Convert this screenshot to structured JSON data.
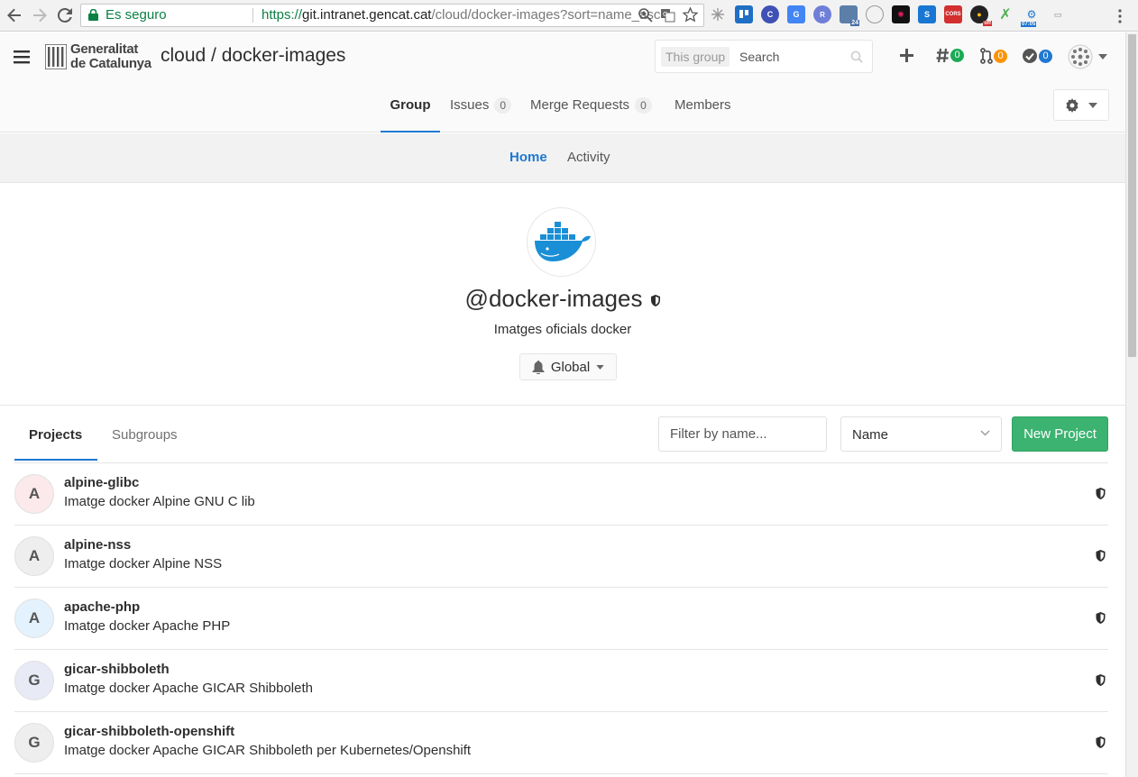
{
  "browser": {
    "secure_label": "Es seguro",
    "url_scheme": "https://",
    "url_host": "git.intranet.gencat.cat",
    "url_path": "/cloud/docker-images?sort=name_asc",
    "extensions": [
      "trello-icon",
      "c-icon",
      "translate-icon",
      "r-icon",
      "calendar-icon",
      "circle-icon",
      "dark-icon",
      "s-icon",
      "cors-icon",
      "chrome-off-icon",
      "spell-icon",
      "clock-icon",
      "ext-icon"
    ],
    "ext_cors": "CORS",
    "ext_off": "off",
    "ext_time": "07:05",
    "ext_cal": "24"
  },
  "header": {
    "logo_line1": "Generalitat",
    "logo_line2": "de Catalunya",
    "title": "cloud / docker-images",
    "search_scope": "This group",
    "search_placeholder": "Search",
    "issues_count": "0",
    "mr_count": "0",
    "todos_count": "0",
    "colors": {
      "issues": "#1aaa55",
      "mr": "#fc9403",
      "todos": "#1f78d1"
    }
  },
  "group_nav": {
    "tabs": [
      {
        "label": "Group"
      },
      {
        "label": "Issues",
        "badge": "0"
      },
      {
        "label": "Merge Requests",
        "badge": "0"
      },
      {
        "label": "Members"
      }
    ]
  },
  "sub_nav": {
    "tabs": [
      "Home",
      "Activity"
    ]
  },
  "group": {
    "name": "@docker-images",
    "description": "Imatges oficials docker",
    "notification_label": "Global"
  },
  "projects_section": {
    "tabs": [
      "Projects",
      "Subgroups"
    ],
    "filter_placeholder": "Filter by name...",
    "sort_value": "Name",
    "new_project_label": "New Project"
  },
  "projects": [
    {
      "initial": "A",
      "name": "alpine-glibc",
      "description": "Imatge docker Alpine GNU C lib",
      "avatar_bg": "#fbe9eb"
    },
    {
      "initial": "A",
      "name": "alpine-nss",
      "description": "Imatge docker Alpine NSS",
      "avatar_bg": "#eeeeee"
    },
    {
      "initial": "A",
      "name": "apache-php",
      "description": "Imatge docker Apache PHP",
      "avatar_bg": "#e3f2fd"
    },
    {
      "initial": "G",
      "name": "gicar-shibboleth",
      "description": "Imatge docker Apache GICAR Shibboleth",
      "avatar_bg": "#e8eaf6"
    },
    {
      "initial": "G",
      "name": "gicar-shibboleth-openshift",
      "description": "Imatge docker Apache GICAR Shibboleth per Kubernetes/Openshift",
      "avatar_bg": "#eeeeee"
    }
  ]
}
